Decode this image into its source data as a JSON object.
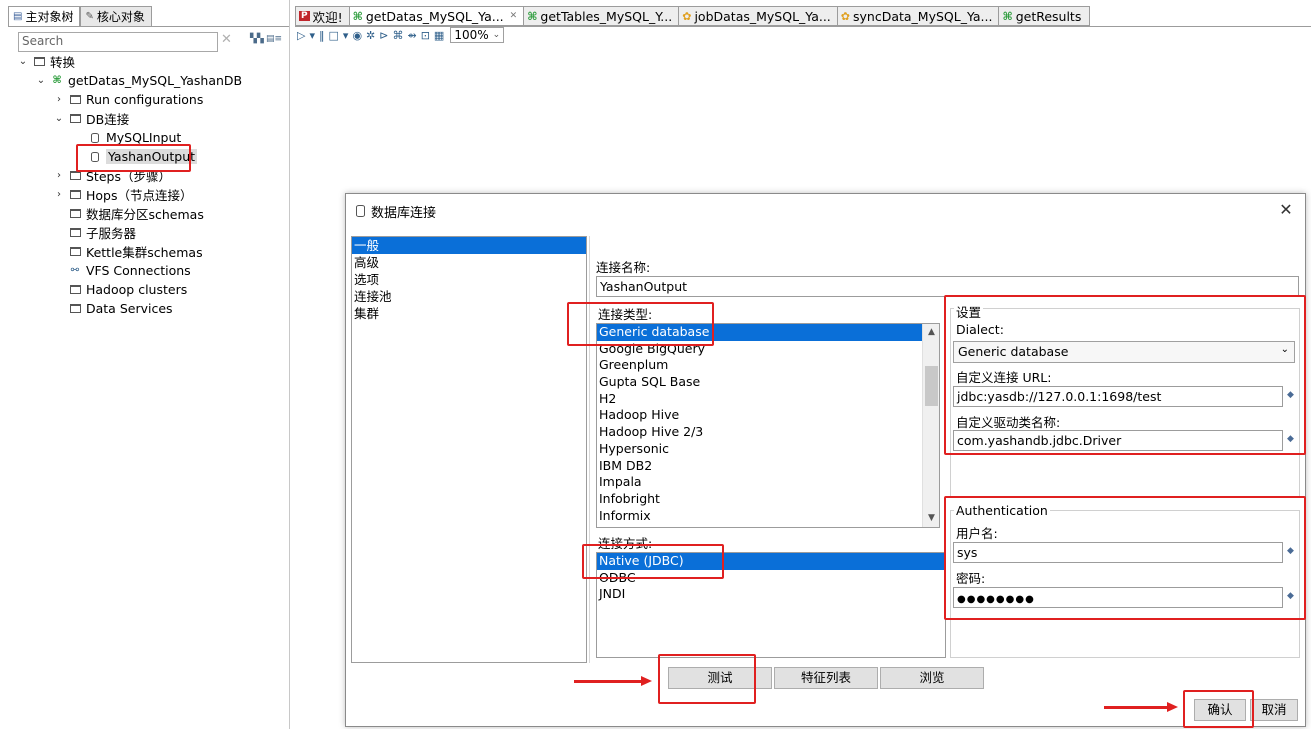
{
  "left_panel": {
    "tabs": [
      "主对象树",
      "核心对象"
    ],
    "search_placeholder": "Search",
    "tree": {
      "root": "转换",
      "transformation": "getDatas_MySQL_YashanDB",
      "run_configurations": "Run configurations",
      "db_connections": "DB连接",
      "connection_1": "MySQLInput",
      "connection_2": "YashanOutput",
      "steps": "Steps（步骤）",
      "hops": "Hops（节点连接）",
      "partition_schemas": "数据库分区schemas",
      "slave_servers": "子服务器",
      "cluster_schemas": "Kettle集群schemas",
      "vfs": "VFS Connections",
      "hadoop": "Hadoop clusters",
      "data_services": "Data Services"
    }
  },
  "editor": {
    "tabs": [
      "欢迎!",
      "getDatas_MySQL_Ya...",
      "getTables_MySQL_Y...",
      "jobDatas_MySQL_Ya...",
      "syncData_MySQL_Ya...",
      "getResults"
    ],
    "zoom": "100%"
  },
  "dialog": {
    "title": "数据库连接",
    "categories": [
      "一般",
      "高级",
      "选项",
      "连接池",
      "集群"
    ],
    "connection_name_label": "连接名称:",
    "connection_name_value": "YashanOutput",
    "connection_type_label": "连接类型:",
    "connection_types": [
      "Generic database",
      "Google BigQuery",
      "Greenplum",
      "Gupta SQL Base",
      "H2",
      "Hadoop Hive",
      "Hadoop Hive 2/3",
      "Hypersonic",
      "IBM DB2",
      "Impala",
      "Infobright",
      "Informix"
    ],
    "access_label": "连接方式:",
    "access_methods": [
      "Native (JDBC)",
      "ODBC",
      "JNDI"
    ],
    "settings": {
      "title": "设置",
      "dialect_label": "Dialect:",
      "dialect_value": "Generic database",
      "url_label": "自定义连接 URL:",
      "url_value": "jdbc:yasdb://127.0.0.1:1698/test",
      "driver_label": "自定义驱动类名称:",
      "driver_value": "com.yashandb.jdbc.Driver"
    },
    "auth": {
      "title": "Authentication",
      "user_label": "用户名:",
      "user_value": "sys",
      "password_label": "密码:",
      "password_value": "●●●●●●●●"
    },
    "buttons": {
      "test": "测试",
      "features": "特征列表",
      "explore": "浏览",
      "ok": "确认",
      "cancel": "取消"
    }
  },
  "colors": {
    "selection": "#0a6fd8",
    "annotation": "#e02020"
  }
}
